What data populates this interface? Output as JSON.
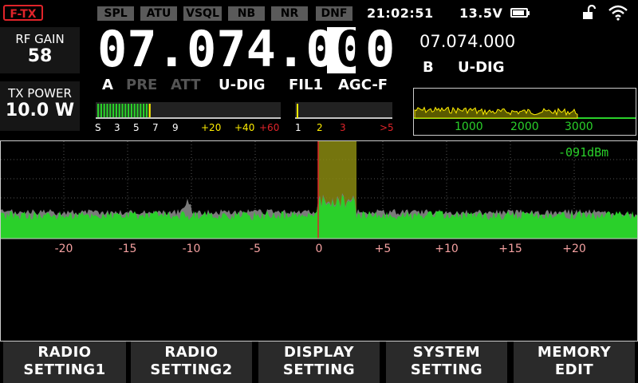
{
  "status": {
    "logo": "F-TX",
    "indicators": [
      "SPL",
      "ATU",
      "VSQL",
      "NB",
      "NR",
      "DNF"
    ],
    "time": "21:02:51",
    "voltage": "13.5V",
    "battery_level": 0.9
  },
  "left": {
    "rf_gain_label": "RF GAIN",
    "rf_gain_value": "58",
    "tx_power_label": "TX POWER",
    "tx_power_value": "10.0 W"
  },
  "main": {
    "frequency": "07.074.000",
    "vfo": "A",
    "pre": "PRE",
    "att": "ATT",
    "mode": "U-DIG",
    "filter": "FIL1",
    "agc": "AGC-F"
  },
  "sub": {
    "frequency": "07.074.000",
    "vfo": "B",
    "mode": "U-DIG"
  },
  "s_meter": {
    "scale": [
      "S",
      "3",
      "5",
      "7",
      "9",
      "+20",
      "+40",
      "+60"
    ],
    "level": 0.3
  },
  "swr_meter": {
    "scale": [
      "1",
      "2",
      "3",
      ">5"
    ]
  },
  "audio_scope": {
    "ticks": [
      "1000",
      "2000",
      "3000"
    ]
  },
  "spectrum": {
    "level_readout": "-091dBm",
    "offsets": [
      "-20",
      "-15",
      "-10",
      "-5",
      "0",
      "+5",
      "+10",
      "+15",
      "+20"
    ]
  },
  "buttons": [
    {
      "line1": "RADIO",
      "line2": "SETTING1"
    },
    {
      "line1": "RADIO",
      "line2": "SETTING2"
    },
    {
      "line1": "DISPLAY",
      "line2": "SETTING"
    },
    {
      "line1": "SYSTEM",
      "line2": "SETTING"
    },
    {
      "line1": "MEMORY",
      "line2": "EDIT"
    }
  ],
  "colors": {
    "accent_red": "#e0242a",
    "spectrum_green": "#2ad02a",
    "passband_yellow": "#8a8a10",
    "meter_yellow": "#ffee00"
  }
}
